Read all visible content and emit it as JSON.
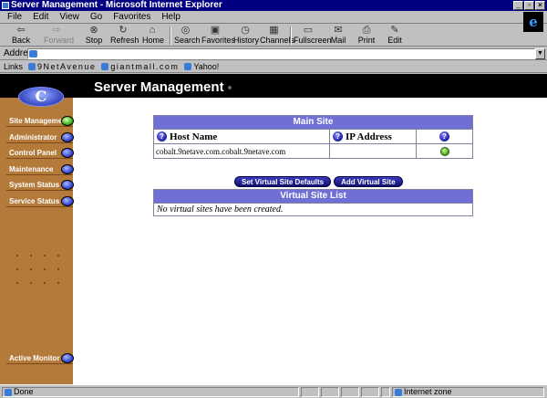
{
  "window": {
    "title": "Server Management - Microsoft Internet Explorer",
    "controls": [
      "_",
      "▫",
      "×"
    ]
  },
  "menu": [
    "File",
    "Edit",
    "View",
    "Go",
    "Favorites",
    "Help"
  ],
  "toolbar": {
    "back": "Back",
    "forward": "Forward",
    "stop": "Stop",
    "refresh": "Refresh",
    "home": "Home",
    "search": "Search",
    "favorites": "Favorites",
    "history": "History",
    "channels": "Channels",
    "fullscreen": "Fullscreen",
    "mail": "Mail",
    "print": "Print",
    "edit": "Edit"
  },
  "address": {
    "label": "Address",
    "value": ""
  },
  "links": {
    "label": "Links",
    "items": [
      "9NetAvenue",
      "giantmall.com",
      "Yahoo!"
    ]
  },
  "page": {
    "title": "Server Management",
    "logo_glyph": "C"
  },
  "sidebar": {
    "items": [
      "Site Management",
      "Administrator",
      "Control Panel",
      "Maintenance",
      "System Status",
      "Service Status"
    ],
    "footer": "Active Monitor"
  },
  "main_site": {
    "header": "Main Site",
    "col_host": "Host Name",
    "col_ip": "IP Address",
    "help_glyph": "?",
    "rows": [
      {
        "host": "cobalt.9netave.com.cobalt.9netave.com",
        "ip": ""
      }
    ]
  },
  "buttons": {
    "set_defaults": "Set Virtual Site Defaults",
    "add_site": "Add Virtual Site"
  },
  "virtual_sites": {
    "header": "Virtual Site List",
    "empty": "No virtual sites have been created."
  },
  "status": {
    "left": "Done",
    "zone": "Internet zone"
  },
  "colors": {
    "bar_header": "#6f6fd6",
    "sidebar": "#b47a3a",
    "titlebar": "#000080"
  }
}
